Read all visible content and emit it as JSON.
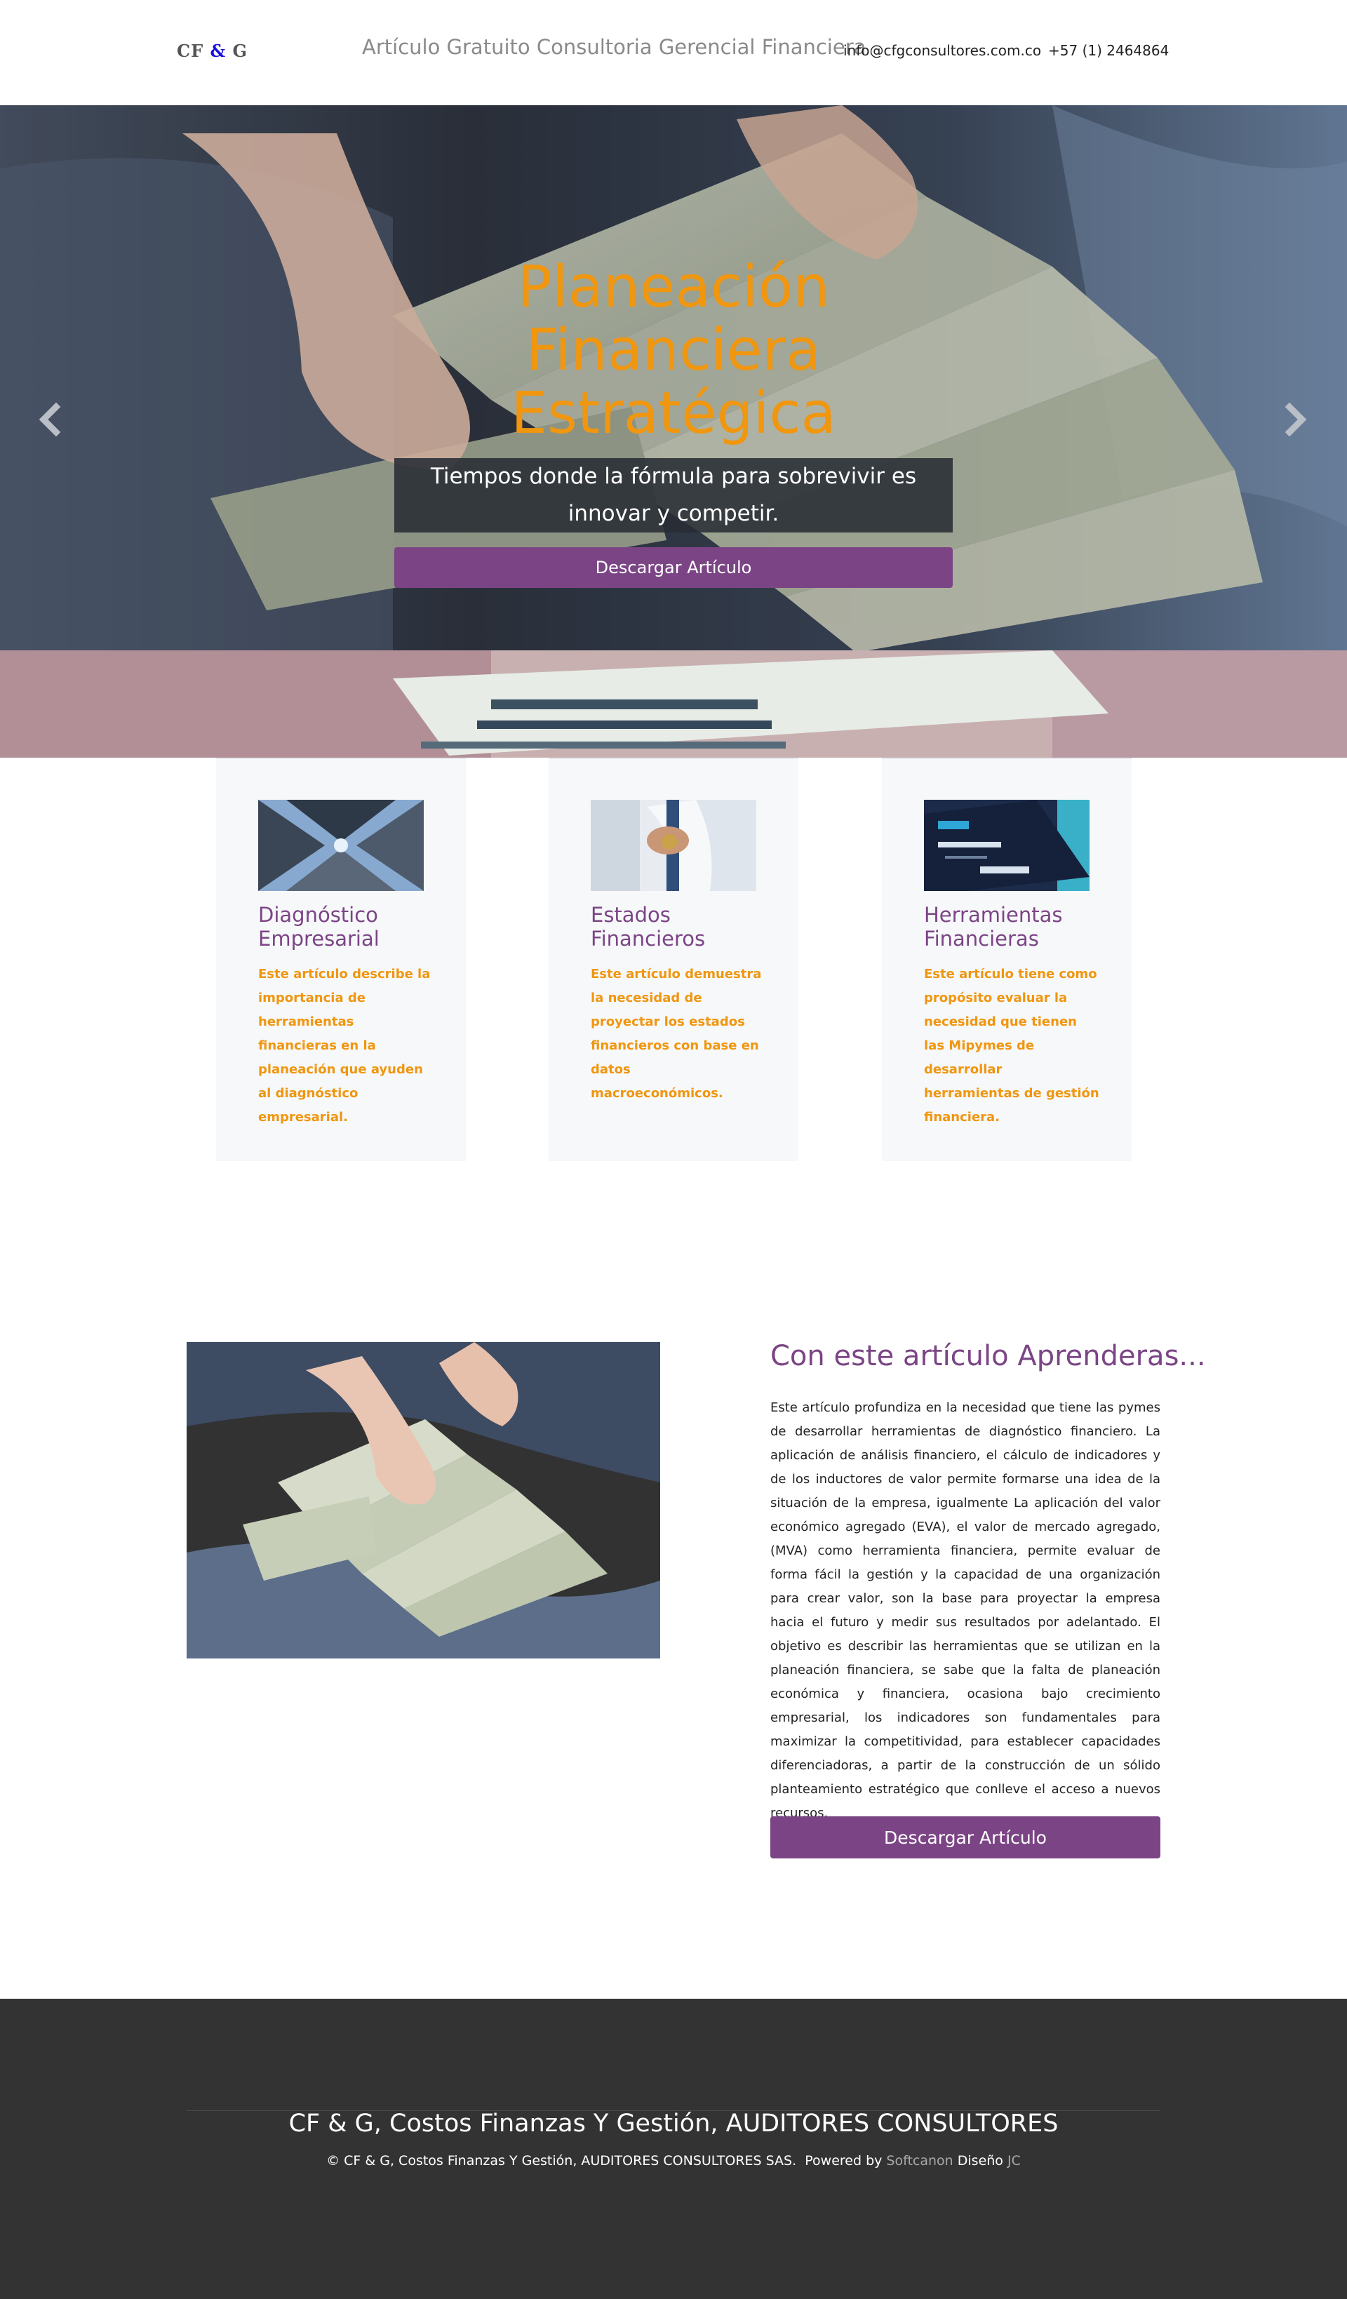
{
  "header": {
    "logo": {
      "left": "CF",
      "amp": "&",
      "right": "G"
    },
    "title": "Artículo Gratuito Consultoria Gerencial Financiera",
    "email": "info@cfgconsultores.com.co",
    "phone": "+57 (1) 2464864"
  },
  "hero": {
    "title_lines": [
      "Planeación",
      "Financiera",
      "Estratégica"
    ],
    "subtitle": "Tiempos donde la fórmula para sobrevivir es innovar y competir.",
    "button_label": "Descargar Artículo"
  },
  "cards": [
    {
      "title": "Diagnóstico Empresarial",
      "text": "Este artículo describe la importancia de herramientas financieras en la planeación que ayuden al diagnóstico empresarial."
    },
    {
      "title": "Estados Financieros",
      "text": "Este artículo demuestra la necesidad de proyectar los estados financieros con base en datos macroeconómicos."
    },
    {
      "title": "Herramientas Financieras",
      "text": "Este artículo tiene como propósito evaluar la necesidad que tienen las Mipymes de desarrollar herramientas de gestión financiera."
    }
  ],
  "article": {
    "title": "Con este artículo Aprenderas...",
    "body": "Este artículo profundiza en la necesidad que tiene las pymes de desarrollar herramientas de diagnóstico financiero. La aplicación de análisis financiero, el cálculo de indicadores y de los inductores de valor permite formarse una idea de la situación de la empresa, igualmente La aplicación del valor económico agregado (EVA), el valor de mercado agregado, (MVA) como herramienta financiera, permite evaluar de forma fácil la gestión y la capacidad de una organización para crear valor, son la base para proyectar la empresa hacia el futuro y medir sus resultados por adelantado. El objetivo es describir las herramientas que se utilizan en la planeación financiera, se sabe que la falta de planeación económica y financiera, ocasiona bajo crecimiento empresarial, los indicadores son fundamentales para maximizar la competitividad, para establecer capacidades diferenciadoras, a partir de la construcción de un sólido planteamiento estratégico que conlleve el acceso a nuevos recursos.",
    "button_label": "Descargar Artículo"
  },
  "footer": {
    "title": "CF & G, Costos Finanzas Y Gestión, AUDITORES CONSULTORES",
    "copyright": "© CF & G, Costos Finanzas Y Gestión, AUDITORES CONSULTORES SAS.",
    "powered_label": "Powered by",
    "powered_brand": "Softcanon",
    "design_label": "Diseño",
    "design_brand": "JC"
  },
  "colors": {
    "accent_orange": "#f0960f",
    "accent_purple": "#7b4585",
    "footer_bg": "#333333"
  },
  "icons": {
    "carousel_prev": "chevron-left-icon",
    "carousel_next": "chevron-right-icon"
  }
}
